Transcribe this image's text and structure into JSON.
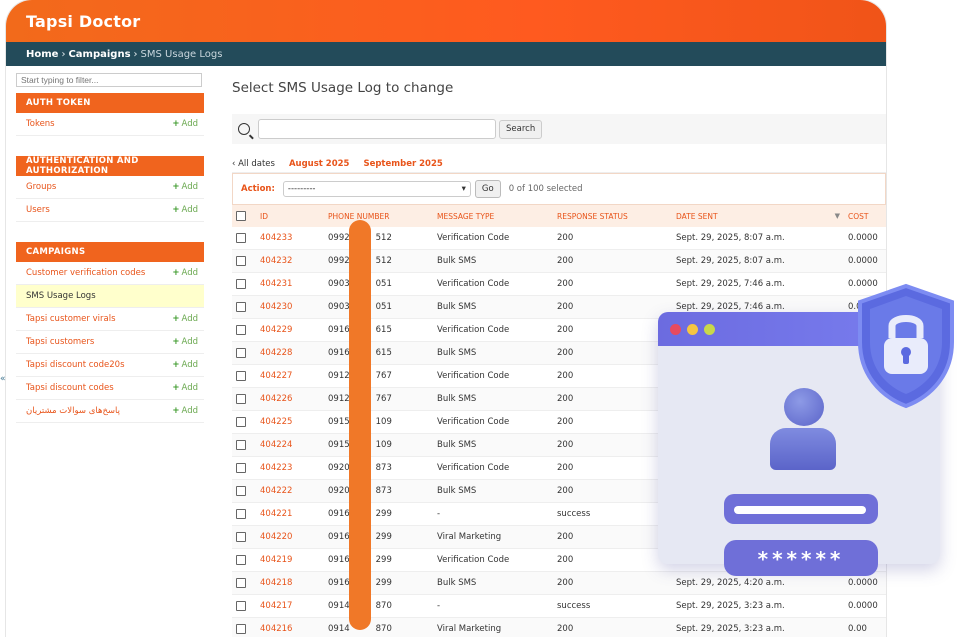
{
  "brand": "Tapsi Doctor",
  "breadcrumbs": {
    "home": "Home",
    "section": "Campaigns",
    "current": "SMS Usage Logs",
    "sep": "›"
  },
  "sidebar": {
    "filter_placeholder": "Start typing to filter...",
    "add_label": "Add",
    "modules": [
      {
        "title": "AUTH TOKEN",
        "items": [
          {
            "label": "Tokens",
            "add": true
          }
        ]
      },
      {
        "title": "AUTHENTICATION AND AUTHORIZATION",
        "items": [
          {
            "label": "Groups",
            "add": true
          },
          {
            "label": "Users",
            "add": true
          }
        ]
      },
      {
        "title": "CAMPAIGNS",
        "items": [
          {
            "label": "Customer verification codes",
            "add": true
          },
          {
            "label": "SMS Usage Logs",
            "add": false,
            "active": true
          },
          {
            "label": "Tapsi customer virals",
            "add": true
          },
          {
            "label": "Tapsi customers",
            "add": true
          },
          {
            "label": "Tapsi discount code20s",
            "add": true
          },
          {
            "label": "Tapsi discount codes",
            "add": true
          },
          {
            "label": "پاسخ‌های سوالات مشتریان",
            "add": true
          }
        ]
      }
    ]
  },
  "collapse_glyph": "«",
  "page_title": "Select SMS Usage Log to change",
  "search": {
    "button": "Search"
  },
  "date_hierarchy": {
    "all": "‹ All dates",
    "links": [
      "August 2025",
      "September 2025"
    ]
  },
  "actions": {
    "label": "Action:",
    "selected": "---------",
    "go": "Go",
    "count": "0 of 100 selected"
  },
  "table": {
    "headers": [
      "ID",
      "PHONE NUMBER",
      "MESSAGE TYPE",
      "RESPONSE STATUS",
      "DATE SENT",
      "COST"
    ],
    "rows": [
      [
        "404233",
        "0992",
        "512",
        "Verification Code",
        "200",
        "Sept. 29, 2025, 8:07 a.m.",
        "0.0000"
      ],
      [
        "404232",
        "0992",
        "512",
        "Bulk SMS",
        "200",
        "Sept. 29, 2025, 8:07 a.m.",
        "0.0000"
      ],
      [
        "404231",
        "0903",
        "051",
        "Verification Code",
        "200",
        "Sept. 29, 2025, 7:46 a.m.",
        "0.0000"
      ],
      [
        "404230",
        "0903",
        "051",
        "Bulk SMS",
        "200",
        "Sept. 29, 2025, 7:46 a.m.",
        "0.0000"
      ],
      [
        "404229",
        "0916",
        "615",
        "Verification Code",
        "200",
        "",
        ""
      ],
      [
        "404228",
        "0916",
        "615",
        "Bulk SMS",
        "200",
        "",
        ""
      ],
      [
        "404227",
        "0912",
        "767",
        "Verification Code",
        "200",
        "",
        ""
      ],
      [
        "404226",
        "0912",
        "767",
        "Bulk SMS",
        "200",
        "",
        ""
      ],
      [
        "404225",
        "0915",
        "109",
        "Verification Code",
        "200",
        "",
        ""
      ],
      [
        "404224",
        "0915",
        "109",
        "Bulk SMS",
        "200",
        "",
        ""
      ],
      [
        "404223",
        "0920",
        "873",
        "Verification Code",
        "200",
        "",
        ""
      ],
      [
        "404222",
        "0920",
        "873",
        "Bulk SMS",
        "200",
        "",
        ""
      ],
      [
        "404221",
        "0916",
        "299",
        "-",
        "success",
        "",
        ""
      ],
      [
        "404220",
        "0916",
        "299",
        "Viral Marketing",
        "200",
        "",
        ""
      ],
      [
        "404219",
        "0916",
        "299",
        "Verification Code",
        "200",
        "",
        ""
      ],
      [
        "404218",
        "0916",
        "299",
        "Bulk SMS",
        "200",
        "Sept. 29, 2025, 4:20 a.m.",
        "0.0000"
      ],
      [
        "404217",
        "0914",
        "870",
        "-",
        "success",
        "Sept. 29, 2025, 3:23 a.m.",
        "0.0000"
      ],
      [
        "404216",
        "0914",
        "870",
        "Viral Marketing",
        "200",
        "Sept. 29, 2025, 3:23 a.m.",
        "0.00"
      ]
    ]
  },
  "illustration": {
    "password_mask": "******"
  },
  "colors": {
    "accent": "#f0641e",
    "breadcrumb_bg": "#234b5a",
    "link": "#e8541a",
    "redaction": "#f07828",
    "illustration": "#6f6fd8"
  }
}
